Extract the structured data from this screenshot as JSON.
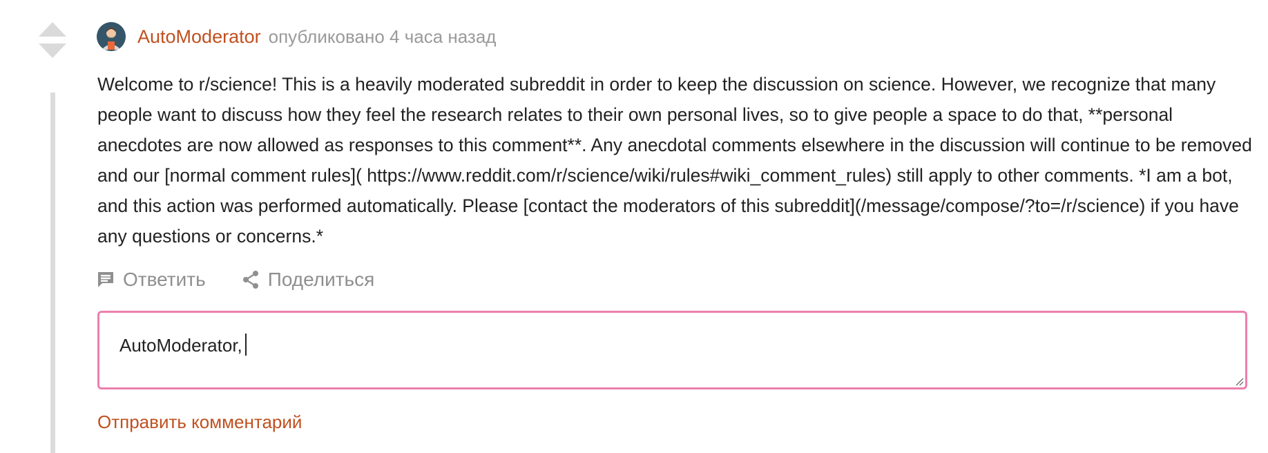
{
  "comment": {
    "author": "AutoModerator",
    "meta": "опубликовано 4 часа назад",
    "body": "Welcome to r/science! This is a heavily moderated subreddit in order to keep the discussion on science. However, we recognize that many people want to discuss how they feel the research relates to their own personal lives, so to give people a space to do that, **personal anecdotes are now allowed as responses to this comment**. Any anecdotal comments elsewhere in the discussion will continue to be removed and our [normal comment rules]( https://www.reddit.com/r/science/wiki/rules#wiki_comment_rules) still apply to other comments. *I am a bot, and this action was performed automatically. Please [contact the moderators of this subreddit](/message/compose/?to=/r/science) if you have any questions or concerns.*"
  },
  "actions": {
    "reply_label": "Ответить",
    "share_label": "Поделиться"
  },
  "reply_box": {
    "value": "AutoModerator,"
  },
  "submit_label": "Отправить комментарий",
  "colors": {
    "accent": "#c0501f",
    "input_border": "#ec7fae",
    "muted": "#8f8f8f"
  },
  "icons": {
    "upvote": "upvote-arrow-icon",
    "downvote": "downvote-arrow-icon",
    "reply": "comment-icon",
    "share": "share-icon",
    "avatar": "avatar-icon"
  }
}
